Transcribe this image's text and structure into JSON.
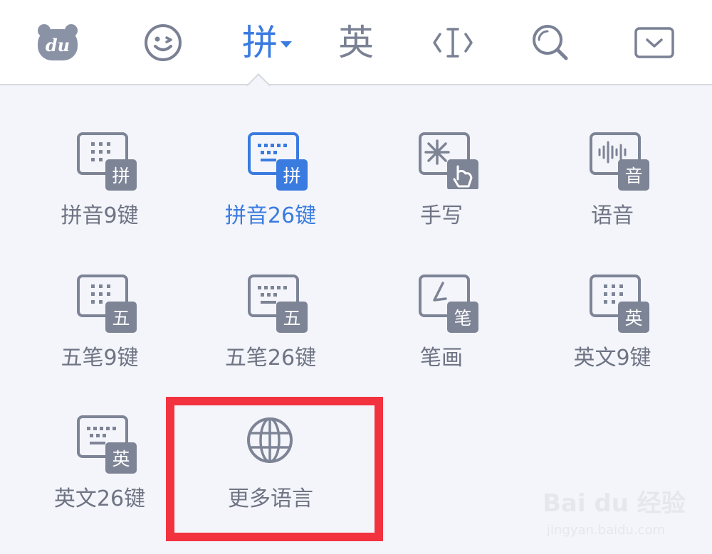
{
  "toolbar": {
    "logo_text": "du",
    "emoji_icon": "smiley-face-icon",
    "pinyin_label": "拼",
    "english_label": "英",
    "cursor_icon": "text-cursor-icon",
    "search_icon": "search-icon",
    "collapse_icon": "keyboard-hide-icon"
  },
  "keyboards": [
    {
      "label": "拼音9键",
      "badge": "拼",
      "icon": "keyboard-9-key-icon"
    },
    {
      "label": "拼音26键",
      "badge": "拼",
      "icon": "keyboard-26-key-icon",
      "selected": true
    },
    {
      "label": "手写",
      "icon": "handwriting-icon"
    },
    {
      "label": "语音",
      "badge": "音",
      "icon": "voice-waveform-icon"
    },
    {
      "label": "五笔9键",
      "badge": "五",
      "icon": "keyboard-9-key-icon"
    },
    {
      "label": "五笔26键",
      "badge": "五",
      "icon": "keyboard-26-key-icon"
    },
    {
      "label": "笔画",
      "badge": "笔",
      "icon": "stroke-icon"
    },
    {
      "label": "英文9键",
      "badge": "英",
      "icon": "keyboard-9-key-icon"
    },
    {
      "label": "英文26键",
      "badge": "英",
      "icon": "keyboard-26-key-icon"
    },
    {
      "label": "更多语言",
      "icon": "globe-icon"
    }
  ],
  "colors": {
    "accent": "#3a7be0",
    "icon_gray": "#7d8496",
    "highlight_red": "#f2323f",
    "panel_bg": "#f4f5fa"
  },
  "watermark": {
    "brand": "Bai du 经验",
    "url": "jingyan.baidu.com"
  }
}
